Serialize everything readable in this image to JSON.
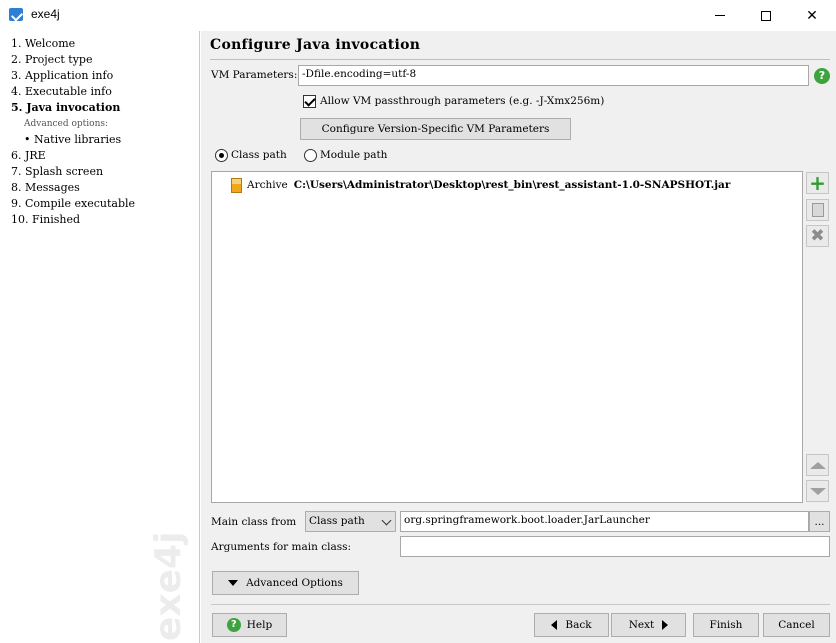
{
  "window": {
    "title": "exe4j",
    "icon": "exe4j-app-icon"
  },
  "sidebar": {
    "steps": [
      {
        "label": "1.  Welcome"
      },
      {
        "label": "2.  Project type"
      },
      {
        "label": "3.  Application info"
      },
      {
        "label": "4.  Executable info"
      },
      {
        "label": "5.  Java invocation",
        "active": true
      }
    ],
    "advanced_header": "Advanced options:",
    "substeps": [
      {
        "label": "• Native libraries"
      }
    ],
    "steps_after": [
      {
        "label": "6.  JRE"
      },
      {
        "label": "7.  Splash screen"
      },
      {
        "label": "8.  Messages"
      },
      {
        "label": "9.  Compile executable"
      },
      {
        "label": "10.  Finished"
      }
    ],
    "watermark": "exe4j"
  },
  "main": {
    "title": "Configure Java invocation",
    "vm_params_label": "VM Parameters:",
    "vm_params_value": "-Dfile.encoding=utf-8",
    "passthrough_label": "Allow VM passthrough parameters (e.g. -J-Xmx256m)",
    "passthrough_checked": true,
    "version_specific_button": "Configure Version-Specific VM Parameters",
    "path_mode": {
      "options": [
        "Class path",
        "Module path"
      ],
      "selected": "Class path"
    },
    "classpath_entries": [
      {
        "kind": "Archive",
        "path": "C:\\Users\\Administrator\\Desktop\\rest_bin\\rest_assistant-1.0-SNAPSHOT.jar"
      }
    ],
    "list_buttons": {
      "add": "plus-icon",
      "edit": "edit-icon",
      "remove": "remove-icon",
      "up": "move-up-icon",
      "down": "move-down-icon"
    },
    "main_class_label": "Main class from",
    "main_class_source": "Class path",
    "main_class_value": "org.springframework.boot.loader.JarLauncher",
    "browse_label": "...",
    "args_label": "Arguments for main class:",
    "args_value": "",
    "advanced_options_button": "Advanced Options"
  },
  "footer": {
    "help": "Help",
    "back": "Back",
    "next": "Next",
    "finish": "Finish",
    "cancel": "Cancel"
  },
  "colors": {
    "panel_bg": "#f0f0f0",
    "help_green": "#3ea33e",
    "add_green": "#2f9e2f"
  }
}
